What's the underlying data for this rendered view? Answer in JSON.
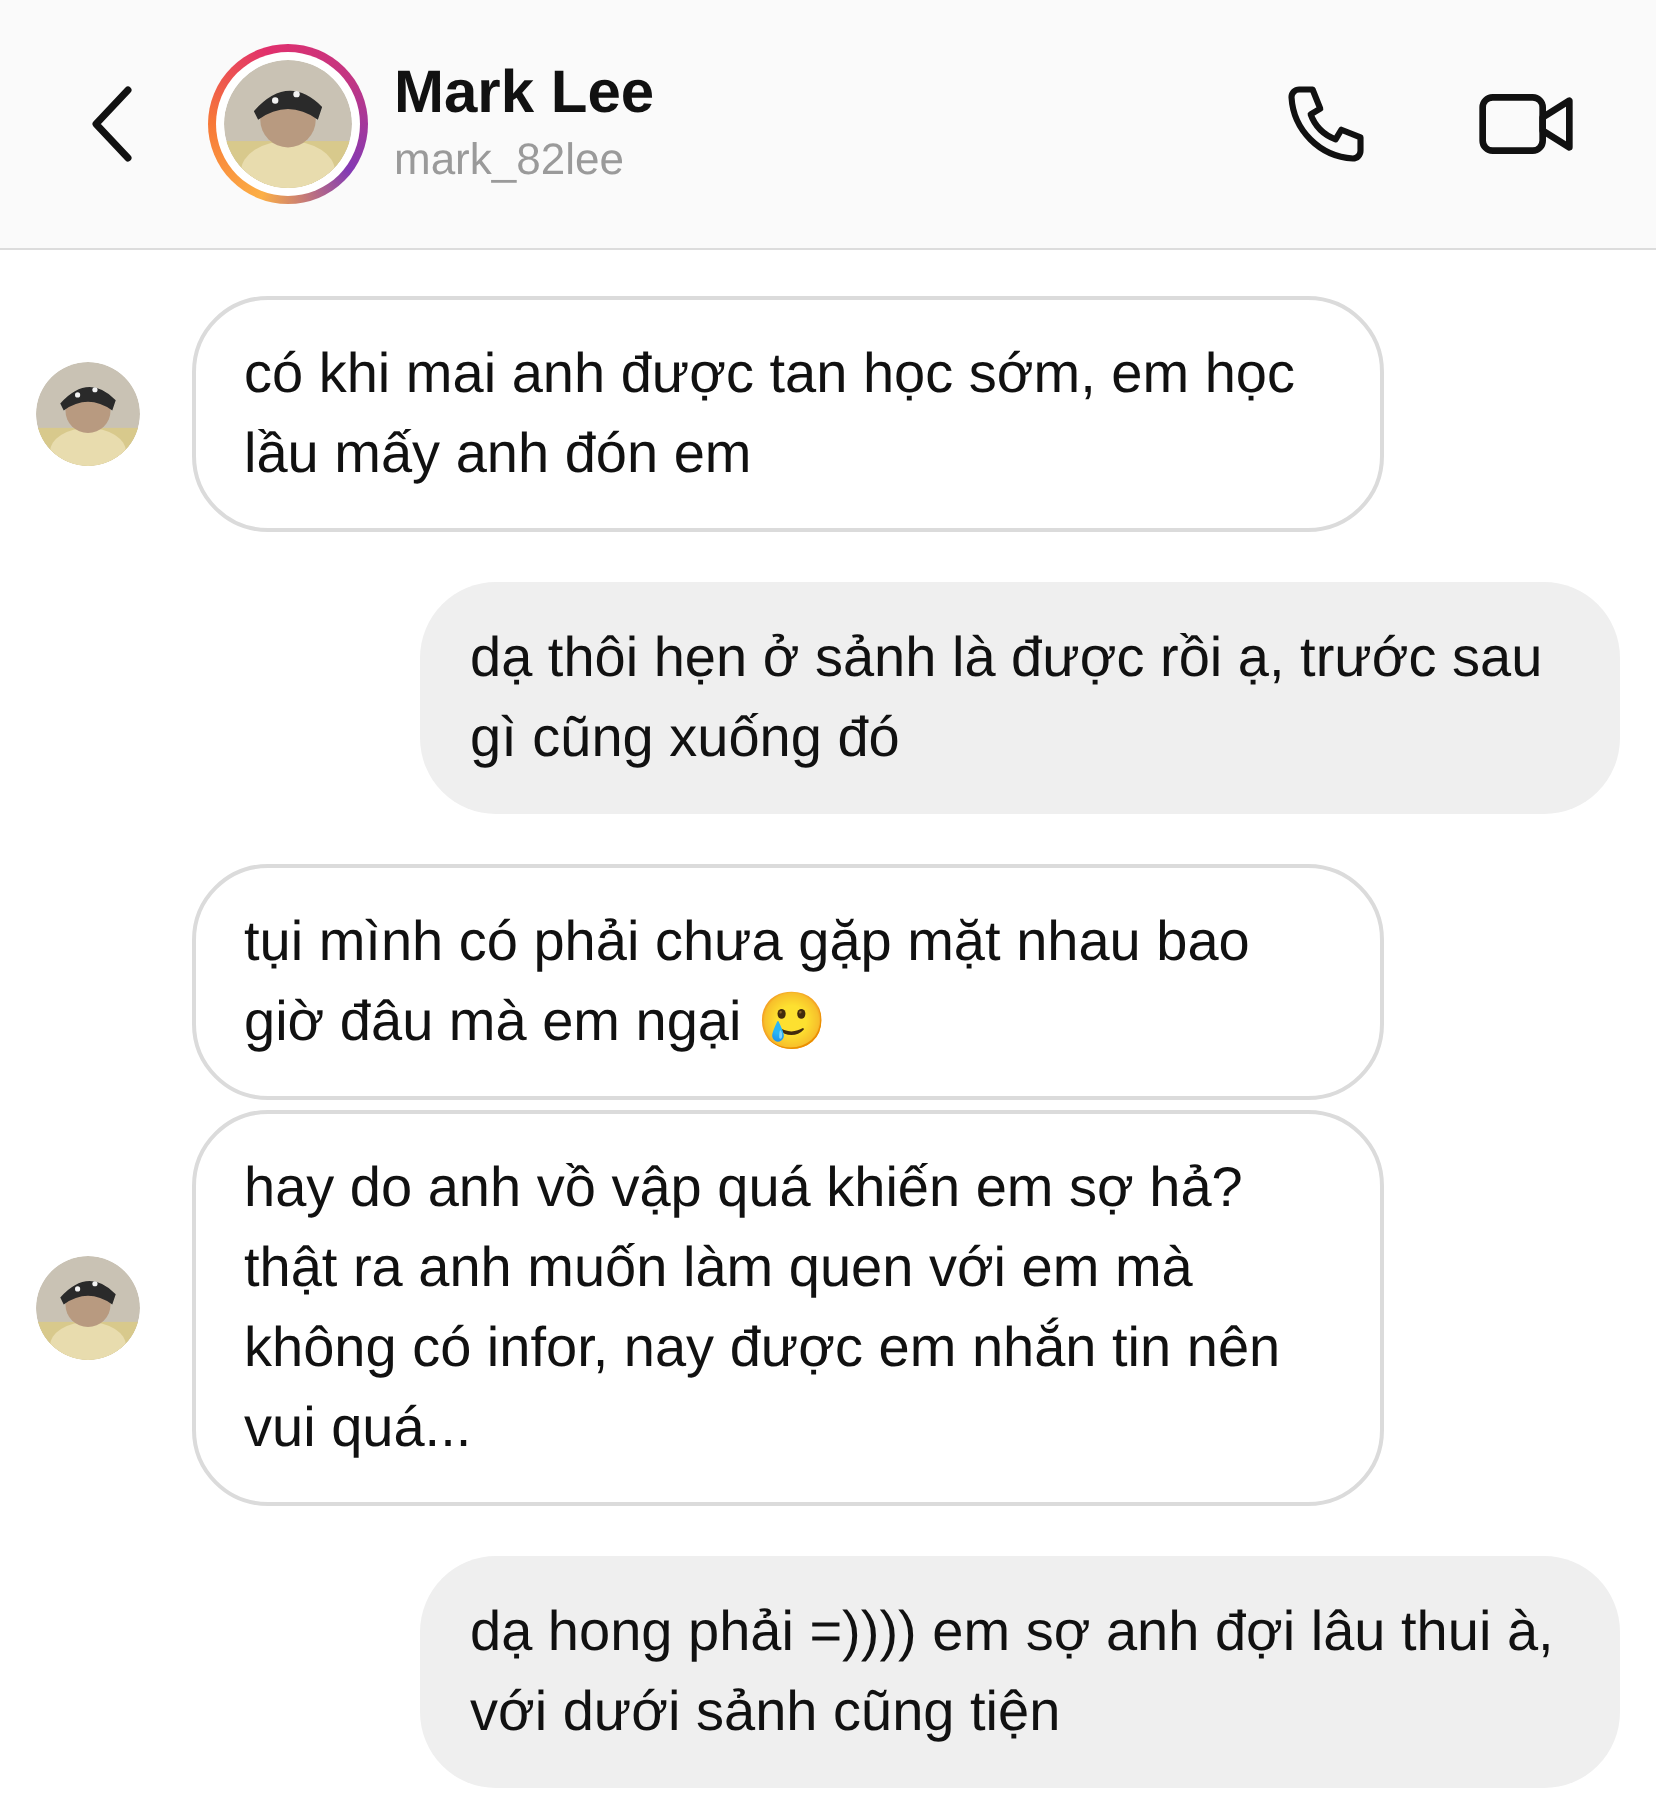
{
  "header": {
    "name": "Mark Lee",
    "username": "mark_82lee",
    "story_ring": true
  },
  "messages": [
    {
      "kind": "received",
      "text": "có khi mai anh được tan học sớm, em học lầu mấy anh đón em",
      "show_avatar": true
    },
    {
      "kind": "sent",
      "text": "dạ thôi hẹn ở sảnh là được rồi ạ, trước sau gì cũng xuống đó"
    },
    {
      "kind": "received",
      "text": "tụi mình có phải chưa gặp mặt nhau bao giờ đâu mà em ngại 🥲",
      "show_avatar": false
    },
    {
      "kind": "received",
      "text": "hay do anh vồ vập quá khiến em sợ hả? thật ra anh muốn làm quen với em mà không có infor, nay được em nhắn tin nên vui quá...",
      "show_avatar": true
    },
    {
      "kind": "sent",
      "text": "dạ hong phải =)))) em sợ anh đợi lâu thui à, với dưới sảnh cũng tiện"
    }
  ]
}
